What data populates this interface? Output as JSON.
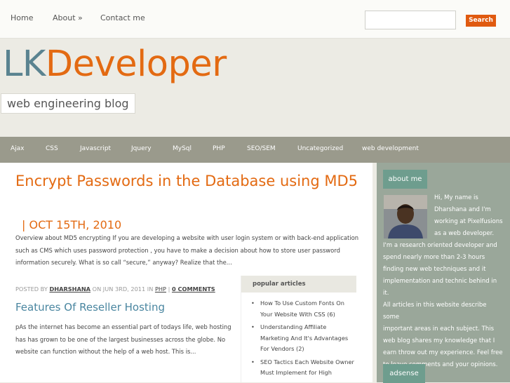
{
  "topnav": [
    "Home",
    "About »",
    "Contact me"
  ],
  "search": {
    "placeholder": "",
    "button_label": "Search"
  },
  "logo": {
    "part1": "LK",
    "part2": "Developer"
  },
  "tagline": "web engineering blog",
  "categories": [
    "Ajax",
    "CSS",
    "Javascript",
    "Jquery",
    "MySql",
    "PHP",
    "SEO/SEM",
    "Uncategorized",
    "web development"
  ],
  "post1": {
    "title": "Encrypt Passwords in the Database using MD5",
    "date": "| OCT 15TH, 2010",
    "excerpt": "Overview about MD5 encrypting If you are developing a website with user login system or with back-end application such as CMS which uses password protection , you have to make a decision about how to store user password information securely. What is so call “secure,” anyway? Realize that the..."
  },
  "post2": {
    "meta_prefix": "POSTED BY",
    "author": "DHARSHANA",
    "date_text": "ON JUN 3RD, 2011 IN",
    "category": "PHP",
    "separator": "|",
    "comments": "0 COMMENTS",
    "title": "Features Of Reseller Hosting",
    "excerpt": "pAs the internet has become an essential part of todays life, web hosting has has grown to be one of the largest businesses across the globe. No website can function without the help of a web host. This is..."
  },
  "popular": {
    "heading": "popular articles",
    "items": [
      "How To Use Custom Fonts On Your Website With CSS (6)",
      "Understanding Affiliate Marketing And It's Advantages For Vendors (2)",
      "SEO Tactics Each Website Owner Must Implement for High"
    ]
  },
  "sidebar": {
    "about_heading": "about me",
    "about_lines": [
      "Hi, My name is",
      "Dharshana and I'm",
      "working at Pixelfusions",
      "as a web developer.",
      "I'm a research oriented developer and",
      "spend nearly more than 2-3 hours",
      "finding new web techniques and it",
      "implementation and technic behind in it.",
      "All articles in this website describe some",
      "important areas in each subject. This",
      "web blog shares my knowledge that I",
      "earn throw out my experience. Feel free",
      "to leave comments and your opinions."
    ],
    "adsense_heading": "adsense"
  },
  "colors": {
    "accent": "#e36a12",
    "logo_blue": "#5a8390",
    "catbar": "#9a9a8c",
    "sidebar": "#9aa79a",
    "badge": "#6e9d8e",
    "link_blue": "#4a86a0"
  }
}
